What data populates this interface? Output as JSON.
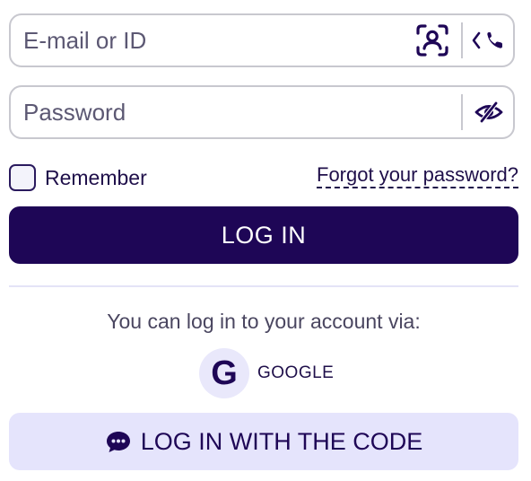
{
  "email": {
    "placeholder": "E-mail or ID",
    "value": "",
    "face_icon": "face-id-icon",
    "switch_icon": "phone-icon"
  },
  "password": {
    "placeholder": "Password",
    "value": "",
    "toggle_icon": "eye-icon"
  },
  "remember": {
    "label": "Remember",
    "checked": false
  },
  "forgot": {
    "label": "Forgot your password?"
  },
  "login": {
    "label": "LOG IN"
  },
  "alternatives": {
    "heading": "You can log in to your account via:",
    "google": {
      "glyph": "G",
      "label": "GOOGLE"
    },
    "code_button": {
      "label": "LOG IN WITH THE CODE",
      "icon": "chat-icon"
    }
  },
  "colors": {
    "primary": "#1e0656",
    "secondary_bg": "#e5e4fc",
    "border": "#c8c8cf"
  }
}
